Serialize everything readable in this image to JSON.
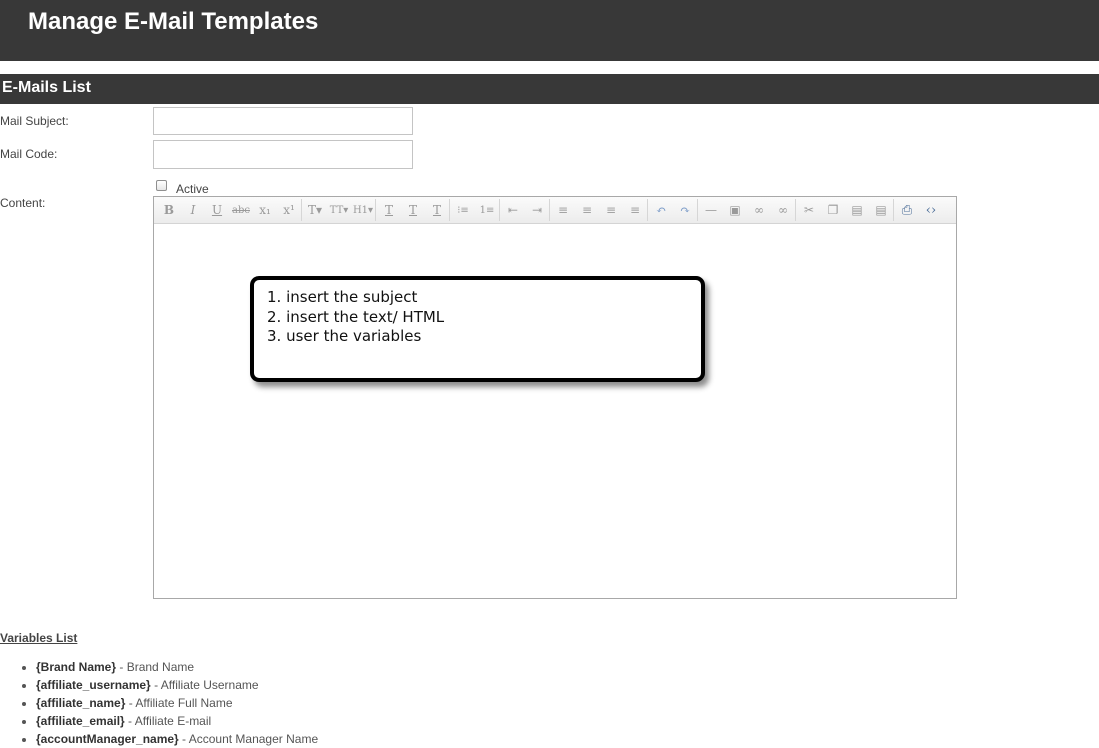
{
  "header": {
    "title": "Manage E-Mail Templates"
  },
  "section": {
    "title": "E-Mails List"
  },
  "form": {
    "mail_subject_label": "Mail Subject:",
    "mail_subject_value": "",
    "mail_code_label": "Mail Code:",
    "mail_code_value": "",
    "active_label": "Active",
    "active_checked": false,
    "content_label": "Content:"
  },
  "toolbar": {
    "buttons": [
      {
        "name": "bold-icon",
        "glyph": "B"
      },
      {
        "name": "italic-icon",
        "glyph": "I"
      },
      {
        "name": "underline-icon",
        "glyph": "U"
      },
      {
        "name": "strikethrough-icon",
        "glyph": "abc"
      },
      {
        "name": "subscript-icon",
        "glyph": "x₁"
      },
      {
        "name": "superscript-icon",
        "glyph": "x¹"
      },
      {
        "name": "font-family-icon",
        "glyph": "T▾"
      },
      {
        "name": "font-size-icon",
        "glyph": "TT▾"
      },
      {
        "name": "heading-icon",
        "glyph": "H1▾"
      },
      {
        "name": "text-color-icon",
        "glyph": "T"
      },
      {
        "name": "highlight-icon",
        "glyph": "T"
      },
      {
        "name": "remove-format-icon",
        "glyph": "T"
      },
      {
        "name": "unordered-list-icon",
        "glyph": "⁝≡"
      },
      {
        "name": "ordered-list-icon",
        "glyph": "1≡"
      },
      {
        "name": "outdent-icon",
        "glyph": "⇤"
      },
      {
        "name": "indent-icon",
        "glyph": "⇥"
      },
      {
        "name": "align-left-icon",
        "glyph": "≡"
      },
      {
        "name": "align-center-icon",
        "glyph": "≡"
      },
      {
        "name": "align-right-icon",
        "glyph": "≡"
      },
      {
        "name": "align-justify-icon",
        "glyph": "≡"
      },
      {
        "name": "undo-icon",
        "glyph": "↶"
      },
      {
        "name": "redo-icon",
        "glyph": "↷"
      },
      {
        "name": "horizontal-rule-icon",
        "glyph": "—"
      },
      {
        "name": "image-icon",
        "glyph": "▣"
      },
      {
        "name": "link-icon",
        "glyph": "∞"
      },
      {
        "name": "unlink-icon",
        "glyph": "∞"
      },
      {
        "name": "cut-icon",
        "glyph": "✂"
      },
      {
        "name": "copy-icon",
        "glyph": "❐"
      },
      {
        "name": "paste-icon",
        "glyph": "▤"
      },
      {
        "name": "paste-text-icon",
        "glyph": "▤"
      },
      {
        "name": "print-icon",
        "glyph": "⎙"
      },
      {
        "name": "source-code-icon",
        "glyph": "‹›"
      }
    ]
  },
  "callout": {
    "lines": [
      "1. insert the subject",
      "2. insert the text/ HTML",
      "3. user the variables"
    ]
  },
  "variables": {
    "title": "Variables List",
    "items": [
      {
        "key": "{Brand Name}",
        "desc": " - Brand Name"
      },
      {
        "key": "{affiliate_username}",
        "desc": " - Affiliate Username"
      },
      {
        "key": "{affiliate_name}",
        "desc": " - Affiliate Full Name"
      },
      {
        "key": "{affiliate_email}",
        "desc": " - Affiliate E-mail"
      },
      {
        "key": "{accountManager_name}",
        "desc": " - Account Manager Name"
      }
    ]
  }
}
